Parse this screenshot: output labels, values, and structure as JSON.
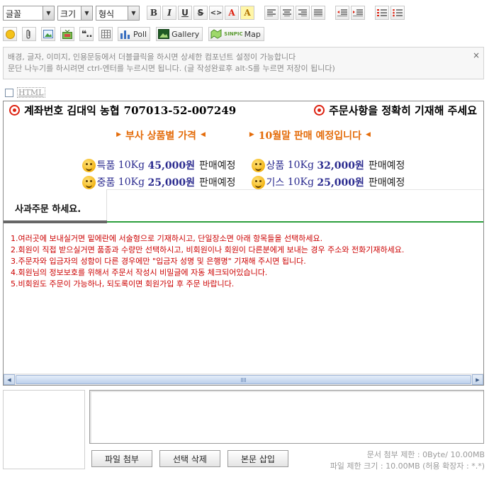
{
  "toolbar": {
    "font_select": "글꼴",
    "size_select": "크기",
    "format_select": "형식",
    "poll_label": "Poll",
    "gallery_label": "Gallery",
    "map_label": "Map",
    "map_brand": "SINPIC"
  },
  "info": {
    "line1": "배경, 글자, 이미지, 인용문등에서 더블클릭을 하시면 상세한 컴포넌트 설정이 가능합니다",
    "line2": "문단 나누기를 하시려면 ctrl-엔터를 누르시면 됩니다. (글 작성완료후 alt-S를 누르면 저장이 됩니다)",
    "close": "×"
  },
  "html_toggle_label": "HTML",
  "editor": {
    "account": "계좌번호 김대익 농협",
    "account_number": "707013-52-007249",
    "order_notice": "주문사항을 정확히 기재해 주세요",
    "price_heading": "부사 상품별 가격",
    "sale_heading": "10월말 판매 예정입니다",
    "prices": [
      {
        "grade": "특품",
        "weight": "10Kg",
        "price": "45,000원",
        "status": "판매예정"
      },
      {
        "grade": "상품",
        "weight": "10Kg",
        "price": "32,000원",
        "status": "판매예정"
      },
      {
        "grade": "중품",
        "weight": "10Kg",
        "price": "25,000원",
        "status": "판매예정"
      },
      {
        "grade": "기스",
        "weight": "10Kg",
        "price": "25,000원",
        "status": "판매예정"
      }
    ],
    "tab_label": "사과주문 하세요.",
    "notes": [
      "1.여러곳에 보내실거면 밑에란에 서술형으로 기재하시고, 단일장소면 아래 항목들을 선택하세요.",
      "2.회원이 직접 받으실거면 품종과 수량만 선택하시고, 비회원이나 회원이 다른분에게 보내는 경우 주소와 전화기재하세요.",
      "3.주문자와 입금자의 성함이 다른 경우에만 \"입금자 성명 및 은행명\" 기재해 주시면 됩니다.",
      "4.회원님의 정보보호를 위해서 주문서 작성시 비밀글에 자동 체크되어있습니다.",
      "5.비회원도 주문이 가능하나, 되도록이면 회원가입 후 주문 바랍니다."
    ]
  },
  "attach": {
    "file_button": "파일 첨부",
    "delete_button": "선택 삭제",
    "insert_button": "본문 삽입",
    "doc_limit": "문서 첨부 제한 : 0Byte/ 10.00MB",
    "file_limit": "파일 제한 크기 : 10.00MB (허용 확장자 : *.*)"
  }
}
